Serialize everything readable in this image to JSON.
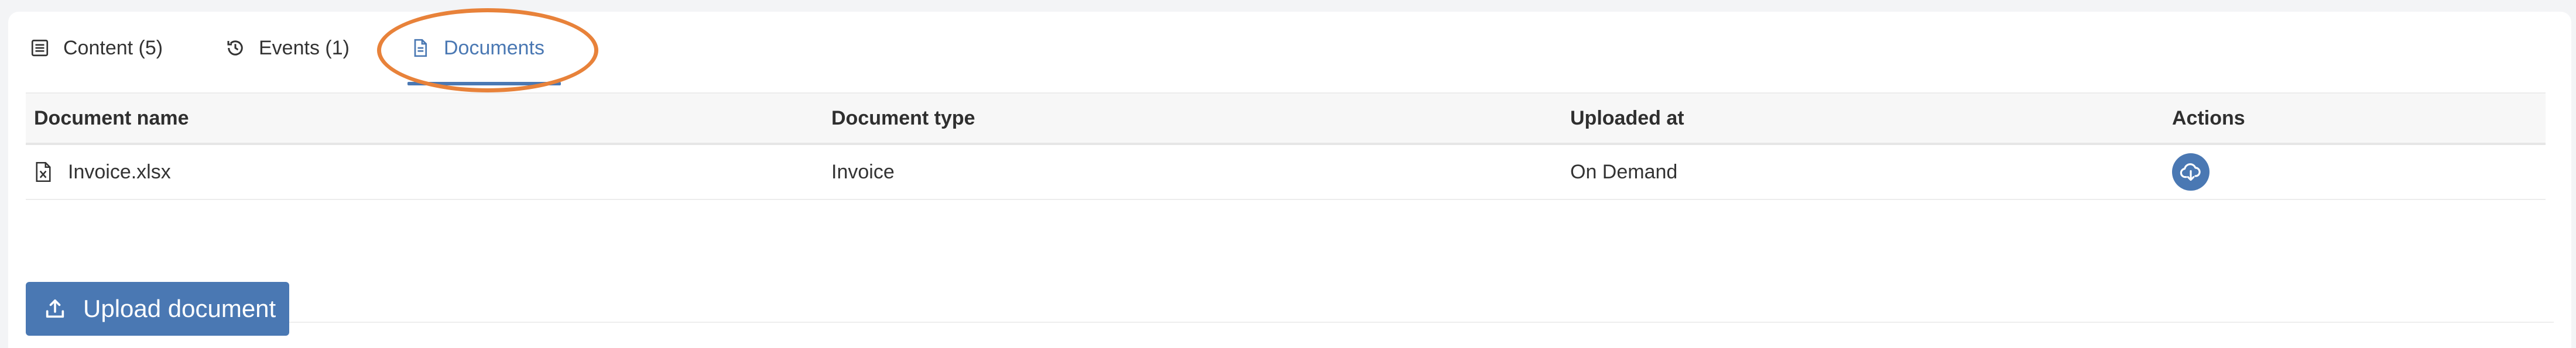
{
  "tabs": [
    {
      "label": "Content (5)",
      "icon": "list-icon",
      "active": false
    },
    {
      "label": "Events (1)",
      "icon": "history-icon",
      "active": false
    },
    {
      "label": "Documents",
      "icon": "document-icon",
      "active": true
    }
  ],
  "table": {
    "headers": [
      "Document name",
      "Document type",
      "Uploaded at",
      "Actions"
    ],
    "rows": [
      {
        "name": "Invoice.xlsx",
        "type": "Invoice",
        "uploaded_at": "On Demand",
        "file_icon": "excel-file-icon",
        "action_icon": "cloud-download-icon"
      }
    ]
  },
  "upload_button": {
    "label": "Upload document",
    "icon": "upload-icon"
  },
  "colors": {
    "accent": "#4a78b3",
    "highlight": "#e8823a"
  }
}
